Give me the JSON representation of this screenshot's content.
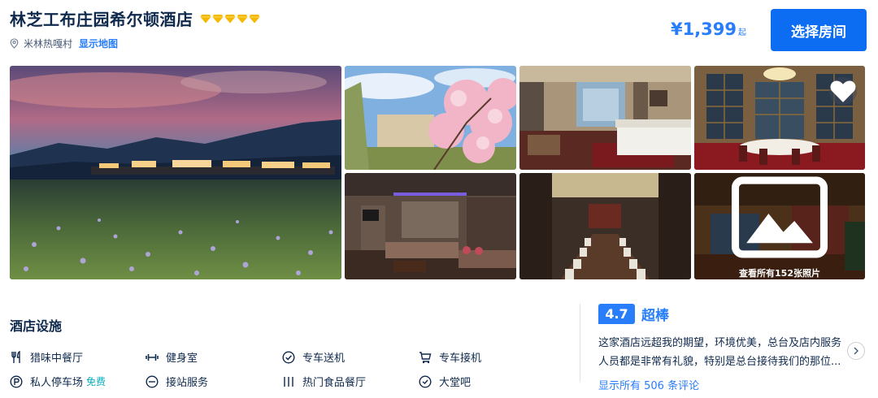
{
  "header": {
    "hotel_name": "林芝工布庄园希尔顿酒店",
    "star_count": 5,
    "star_color": "#f5b800",
    "location": "米林热嘎村",
    "map_link": "显示地图",
    "price": "¥1,399",
    "price_unit": "起",
    "choose_button": "选择房间"
  },
  "gallery": {
    "view_all": "查看所有152张照片",
    "favorite_icon": "heart-icon",
    "photo_icon": "image-icon"
  },
  "facilities": {
    "title": "酒店设施",
    "items": [
      {
        "icon": "dining-icon",
        "label": "猎味中餐厅",
        "tag": ""
      },
      {
        "icon": "dumbbell-icon",
        "label": "健身室",
        "tag": ""
      },
      {
        "icon": "check-circle-icon",
        "label": "专车送机",
        "tag": ""
      },
      {
        "icon": "cart-icon",
        "label": "专车接机",
        "tag": ""
      },
      {
        "icon": "parking-icon",
        "label": "私人停车场",
        "tag": "免费"
      },
      {
        "icon": "laundry-icon",
        "label": "接站服务",
        "tag": ""
      },
      {
        "icon": "breakfast-icon",
        "label": "热门食品餐厅",
        "tag": ""
      },
      {
        "icon": "bar-icon",
        "label": "大堂吧",
        "tag": ""
      }
    ]
  },
  "review": {
    "score": "4.7",
    "score_label": "超棒",
    "text": "这家酒店远超我的期望，环境优美，总台及店内服务人员都是非常有礼貌，特别是总台接待我们的那位...",
    "link": "显示所有 506 条评论"
  },
  "colors": {
    "accent": "#287dfa",
    "button": "#0c6cf2",
    "text": "#0f294d"
  }
}
